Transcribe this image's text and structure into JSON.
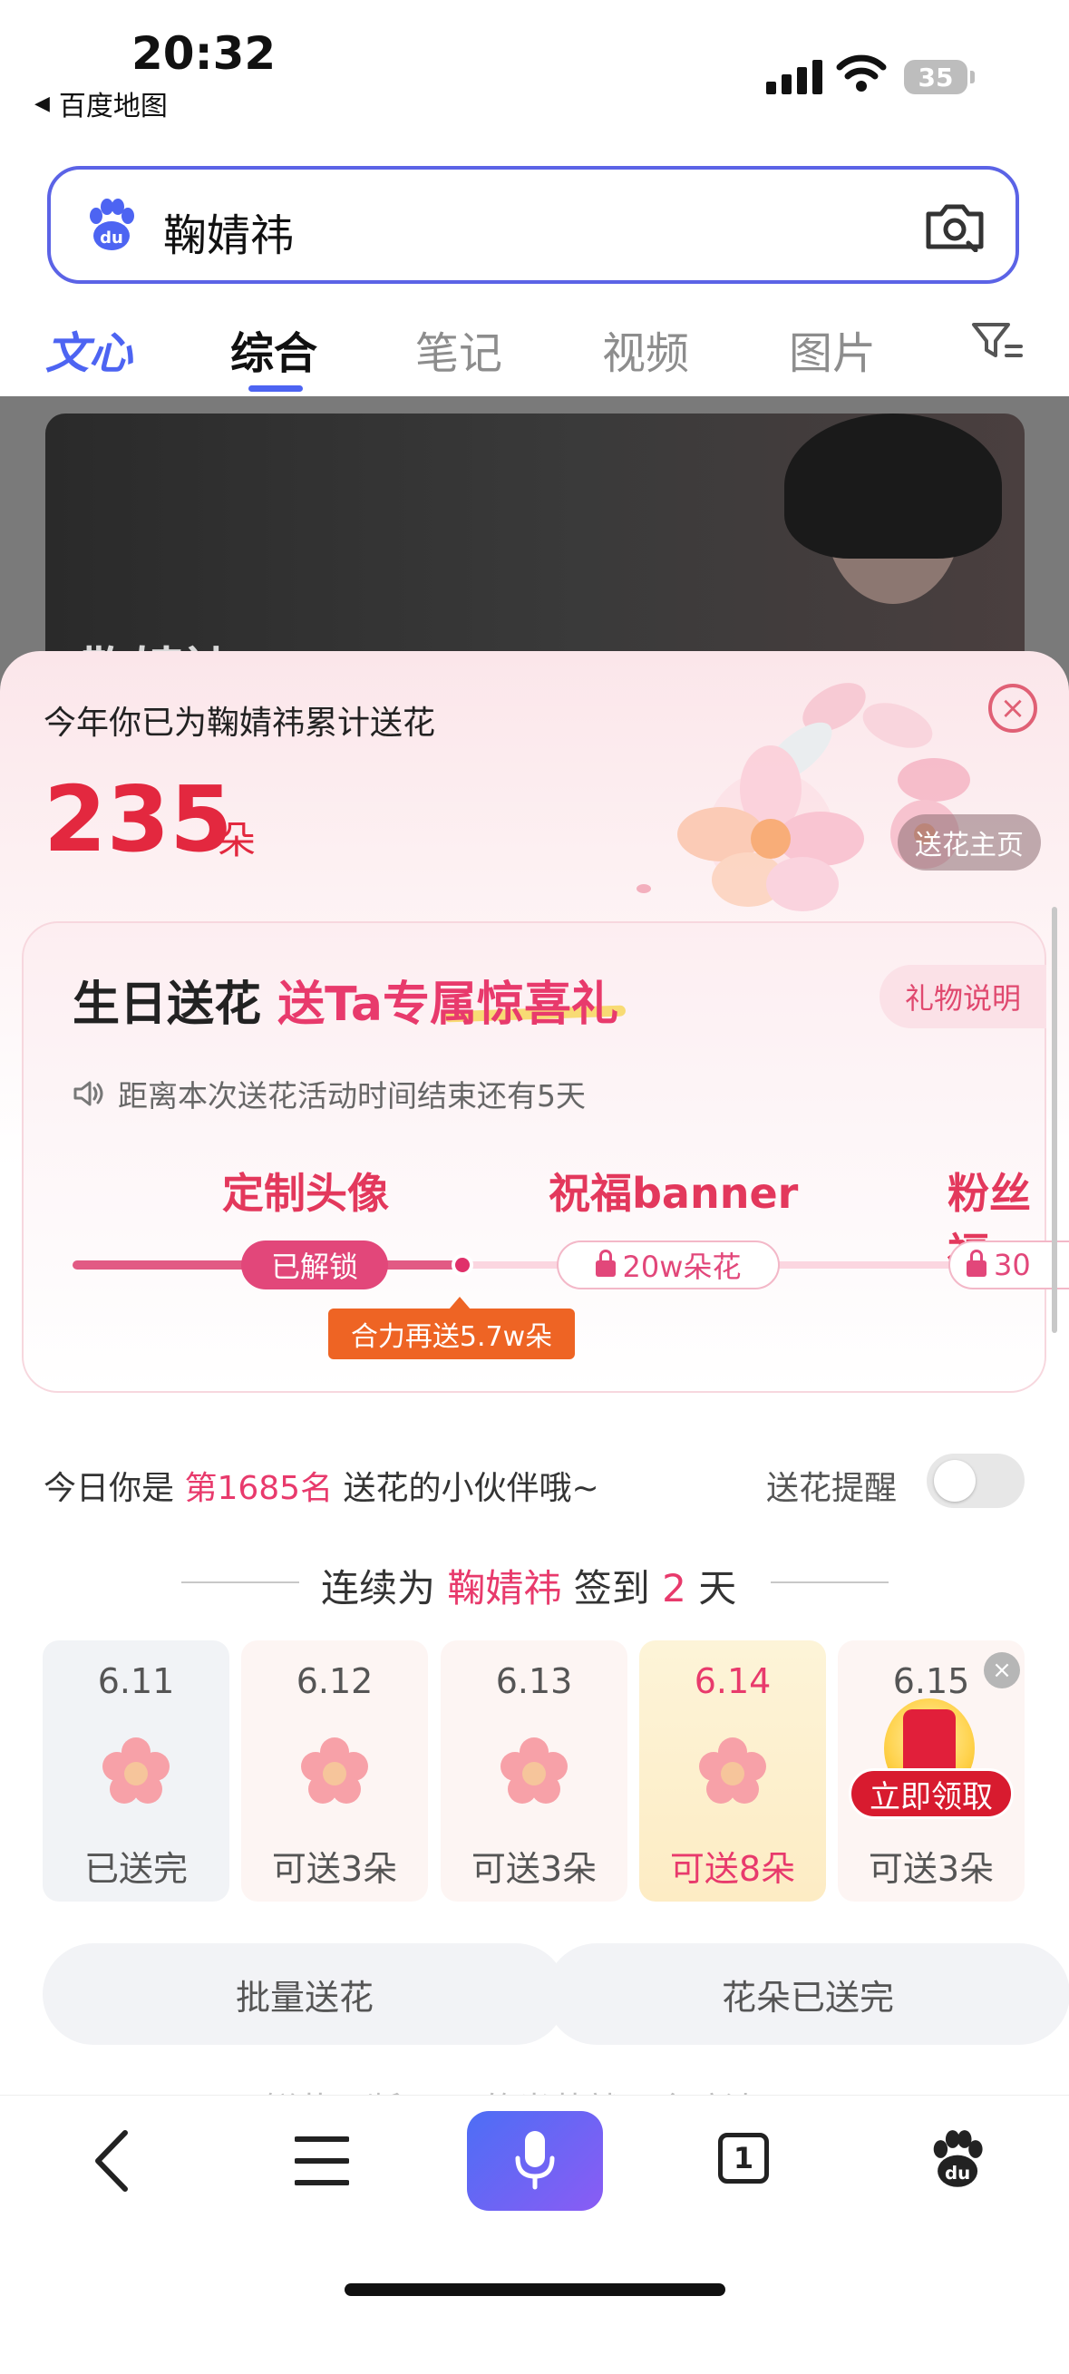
{
  "status_bar": {
    "time": "20:32",
    "back_app": "百度地图",
    "battery": "35"
  },
  "search": {
    "query": "鞠婧祎"
  },
  "tabs": [
    {
      "label": "文心"
    },
    {
      "label": "综合"
    },
    {
      "label": "笔记"
    },
    {
      "label": "视频"
    },
    {
      "label": "图片"
    }
  ],
  "background_card": {
    "name": "鞠婧祎"
  },
  "flower_sheet": {
    "title": "今年你已为鞠婧祎累计送花",
    "count": "235",
    "unit": "朵",
    "home_button": "送花主页",
    "close_label": "×"
  },
  "birthday_card": {
    "title_a": "生日送花",
    "title_b": "送Ta专属惊喜礼",
    "gift_info_button": "礼物说明",
    "notice": "距离本次送花活动时间结束还有5天",
    "milestones": [
      {
        "title": "定制头像",
        "status": "已解锁"
      },
      {
        "title": "祝福banner",
        "status": "20w朵花"
      },
      {
        "title": "粉丝福",
        "status": "30"
      }
    ],
    "tooltip": "合力再送5.7w朵",
    "progress": 0.43
  },
  "rank": {
    "prefix": "今日你是",
    "rank": "第1685名",
    "suffix": "送花的小伙伴哦~",
    "remind_label": "送花提醒",
    "remind_on": false
  },
  "checkin": {
    "prefix": "连续为",
    "name": "鞠婧祎",
    "mid": "签到",
    "days": "2",
    "suffix": "天",
    "days_list": [
      {
        "date": "6.11",
        "status": "已送完"
      },
      {
        "date": "6.12",
        "status": "可送3朵"
      },
      {
        "date": "6.13",
        "status": "可送3朵"
      },
      {
        "date": "6.14",
        "status": "可送8朵"
      },
      {
        "date": "6.15",
        "status": "可送3朵"
      }
    ],
    "claim_label": "立即领取",
    "dismiss_label": "×"
  },
  "actions": {
    "batch": "批量送花",
    "done": "花朵已送完"
  },
  "peek_text": "鲜花不断 ，Ta的光芒就不会暗淡",
  "bottom_nav": {
    "tabs_count": "1"
  },
  "colors": {
    "accent": "#4d64f2",
    "pink": "#e83a6c",
    "red": "#e3283f",
    "orange": "#ee6424"
  }
}
